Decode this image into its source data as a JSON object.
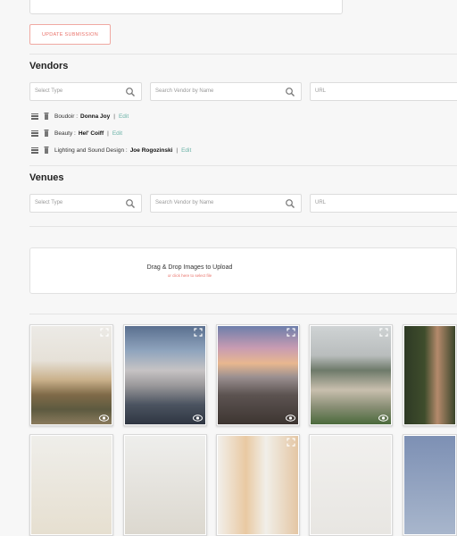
{
  "form": {
    "update_button": "UPDATE SUBMISSION"
  },
  "vendors": {
    "title": "Vendors",
    "type_placeholder": "Select Type",
    "search_placeholder": "Search Vendor by Name",
    "url_placeholder": "URL",
    "items": [
      {
        "category": "Boudoir :",
        "name": "Donna Joy",
        "separator": "|",
        "action": "Edit"
      },
      {
        "category": "Beauty :",
        "name": "Hel' Coiff",
        "separator": "|",
        "action": "Edit"
      },
      {
        "category": "Lighting and Sound Design :",
        "name": "Joe Rogozinski",
        "separator": "|",
        "action": "Edit"
      }
    ]
  },
  "venues": {
    "title": "Venues",
    "type_placeholder": "Select Type",
    "search_placeholder": "Search Vendor by Name",
    "url_placeholder": "URL"
  },
  "upload": {
    "title": "Drag & Drop Images to Upload",
    "subtitle": "or click here to select file"
  },
  "colors": {
    "accent": "#e9736b",
    "link": "#6cb3a8"
  },
  "icons": [
    "search-icon",
    "drag-handle-icon",
    "trash-icon",
    "expand-icon",
    "eye-icon"
  ]
}
